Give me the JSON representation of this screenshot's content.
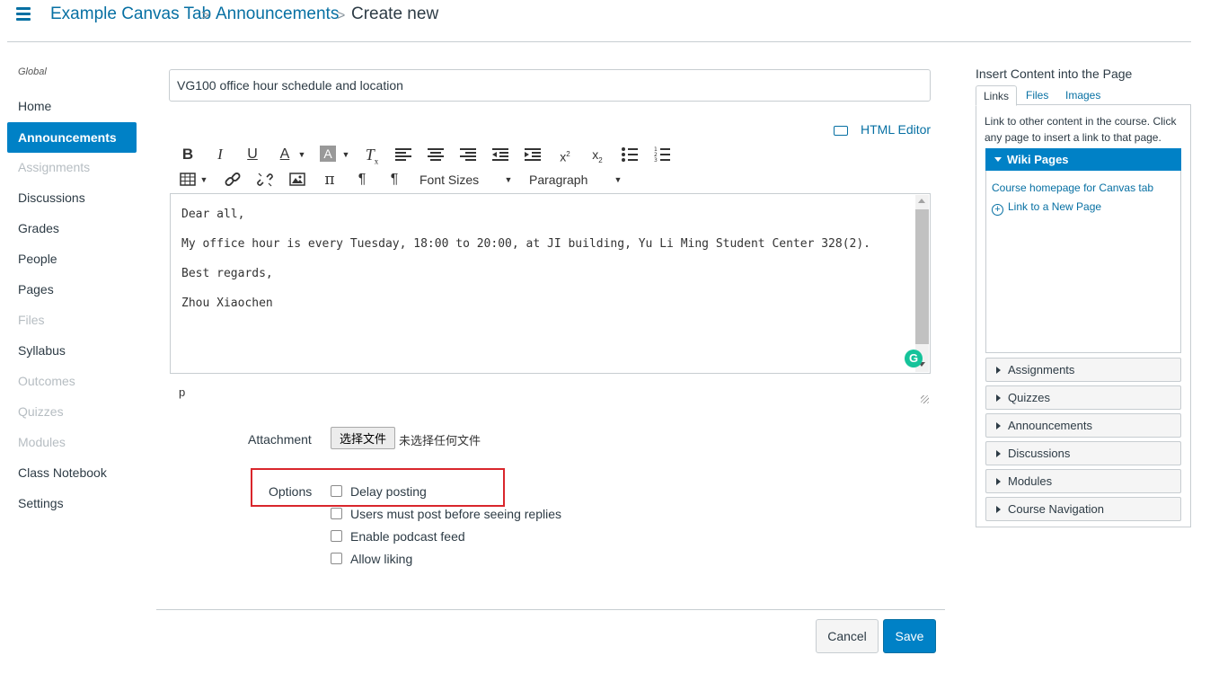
{
  "breadcrumb": {
    "items": [
      "Example Canvas Tab",
      "Announcements",
      "Create new"
    ],
    "separator": ">"
  },
  "nav": {
    "section_label": "Global",
    "items": [
      {
        "label": "Home",
        "state": "normal"
      },
      {
        "label": "Announcements",
        "state": "active"
      },
      {
        "label": "Assignments",
        "state": "disabled"
      },
      {
        "label": "Discussions",
        "state": "normal"
      },
      {
        "label": "Grades",
        "state": "normal"
      },
      {
        "label": "People",
        "state": "normal"
      },
      {
        "label": "Pages",
        "state": "normal"
      },
      {
        "label": "Files",
        "state": "disabled"
      },
      {
        "label": "Syllabus",
        "state": "normal"
      },
      {
        "label": "Outcomes",
        "state": "disabled"
      },
      {
        "label": "Quizzes",
        "state": "disabled"
      },
      {
        "label": "Modules",
        "state": "disabled"
      },
      {
        "label": "Class Notebook",
        "state": "normal"
      },
      {
        "label": "Settings",
        "state": "normal"
      }
    ]
  },
  "form": {
    "title_value": "VG100 office hour schedule and location",
    "html_editor_label": "HTML Editor",
    "toolbar": {
      "font_sizes_label": "Font Sizes",
      "paragraph_label": "Paragraph"
    },
    "body_lines": [
      "Dear all,",
      "My office hour is every Tuesday, 18:00 to 20:00, at JI building, Yu Li Ming Student Center 328(2).",
      "Best regards,",
      "Zhou Xiaochen"
    ],
    "path_indicator": "p",
    "attachment": {
      "label": "Attachment",
      "button_label": "选择文件",
      "status": "未选择任何文件"
    },
    "options": {
      "label": "Options",
      "items": [
        {
          "label": "Delay posting",
          "checked": false
        },
        {
          "label": "Users must post before seeing replies",
          "checked": false
        },
        {
          "label": "Enable podcast feed",
          "checked": false
        },
        {
          "label": "Allow liking",
          "checked": false
        }
      ]
    },
    "cancel_label": "Cancel",
    "save_label": "Save"
  },
  "right_panel": {
    "title": "Insert Content into the Page",
    "tabs": [
      "Links",
      "Files",
      "Images"
    ],
    "active_tab": "Links",
    "description": "Link to other content in the course. Click any page to insert a link to that page.",
    "wiki": {
      "header": "Wiki Pages",
      "link1": "Course homepage for Canvas tab",
      "link2": "Link to a New Page"
    },
    "sections": [
      "Assignments",
      "Quizzes",
      "Announcements",
      "Discussions",
      "Modules",
      "Course Navigation"
    ]
  },
  "colors": {
    "link": "#0770a3",
    "accent": "#0081c6",
    "highlight_box": "#d9262c",
    "grammarly": "#15c39a"
  }
}
